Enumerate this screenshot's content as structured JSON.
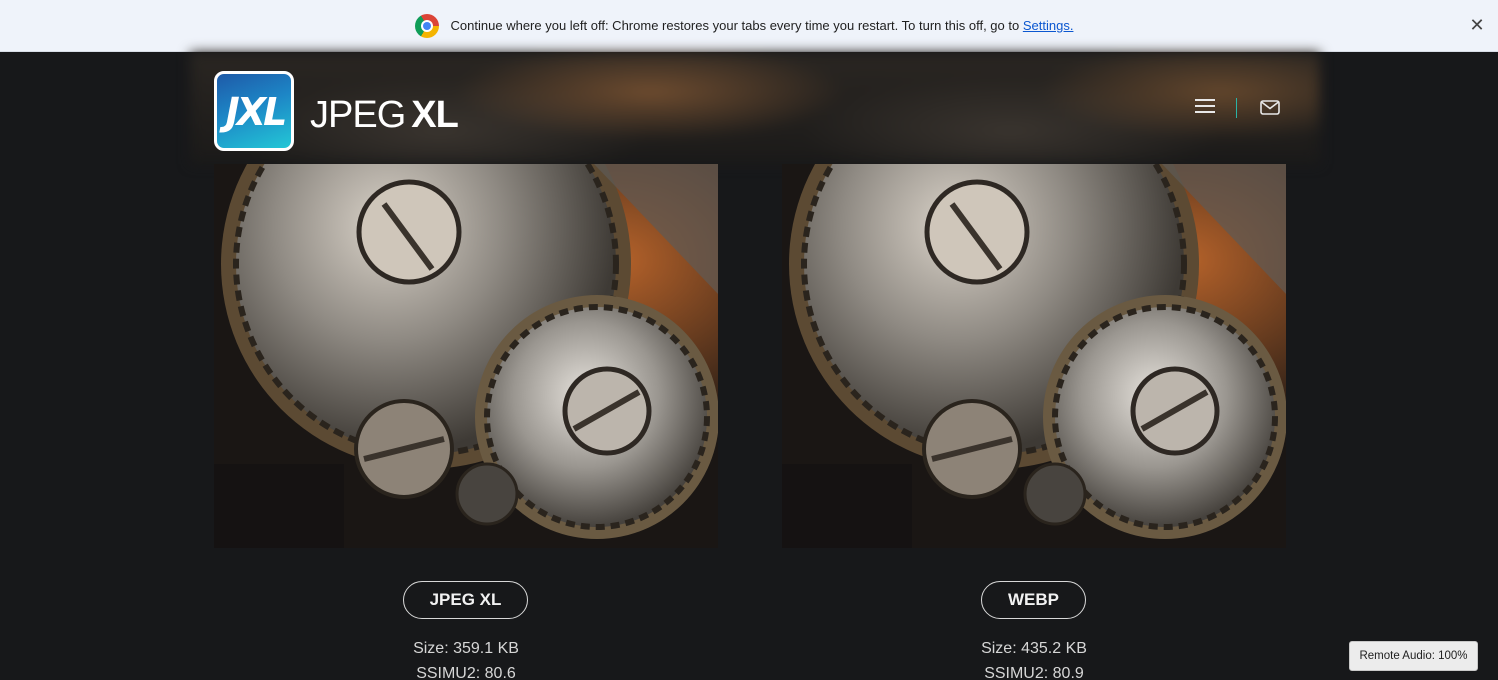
{
  "infobar": {
    "message": "Continue where you left off: Chrome restores your tabs every time you restart. To turn this off, go to",
    "link": "Settings.",
    "close": "✕",
    "icon": "chrome-icon"
  },
  "header": {
    "logo_mark": "JXL",
    "brand_light": "JPEG",
    "brand_bold": "XL",
    "menu_icon": "hamburger-menu-icon",
    "mail_icon": "mail-icon"
  },
  "comparisons": [
    {
      "format": "JPEG XL",
      "size": "Size: 359.1 KB",
      "ssimu2": "SSIMU2: 80.6"
    },
    {
      "format": "WEBP",
      "size": "Size: 435.2 KB",
      "ssimu2": "SSIMU2: 80.9"
    }
  ],
  "overlay": {
    "remote_audio": "Remote Audio: 100%"
  },
  "colors": {
    "background": "#17181a",
    "infobar": "#eff3fa",
    "accent": "#2bb3a5",
    "link": "#0b57d0"
  }
}
